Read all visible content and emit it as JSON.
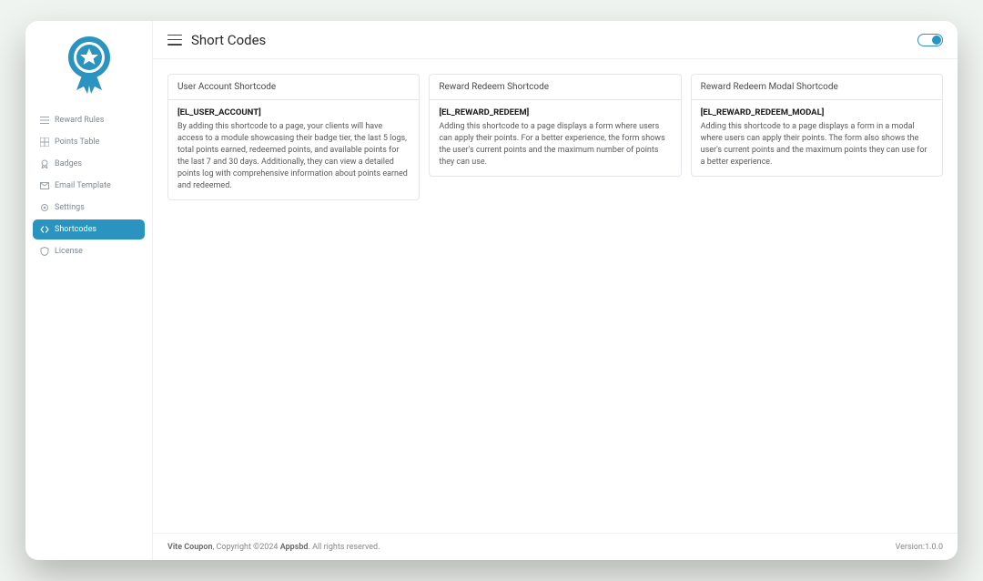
{
  "header": {
    "title": "Short Codes"
  },
  "sidebar": {
    "items": [
      {
        "label": "Reward Rules"
      },
      {
        "label": "Points Table"
      },
      {
        "label": "Badges"
      },
      {
        "label": "Email Template"
      },
      {
        "label": "Settings"
      },
      {
        "label": "Shortcodes"
      },
      {
        "label": "License"
      }
    ],
    "active_index": 5
  },
  "cards": [
    {
      "title": "User Account Shortcode",
      "code": "[EL_USER_ACCOUNT]",
      "description": "By adding this shortcode to a page, your clients will have access to a module showcasing their badge tier, the last 5 logs, total points earned, redeemed points, and available points for the last 7 and 30 days. Additionally, they can view a detailed points log with comprehensive information about points earned and redeemed."
    },
    {
      "title": "Reward Redeem Shortcode",
      "code": "[EL_REWARD_REDEEM]",
      "description": "Adding this shortcode to a page displays a form where users can apply their points. For a better experience, the form shows the user's current points and the maximum number of points they can use."
    },
    {
      "title": "Reward Redeem Modal Shortcode",
      "code": "[EL_REWARD_REDEEM_MODAL]",
      "description": "Adding this shortcode to a page displays a form in a modal where users can apply their points. The form also shows the user's current points and the maximum points they can use for a better experience."
    }
  ],
  "footer": {
    "product": "Vite Coupon",
    "copyright": ", Copyright ©2024 ",
    "company": "Appsbd",
    "rights": ". All rights reserved.",
    "version_label": "Version:",
    "version": "1.0.0"
  }
}
